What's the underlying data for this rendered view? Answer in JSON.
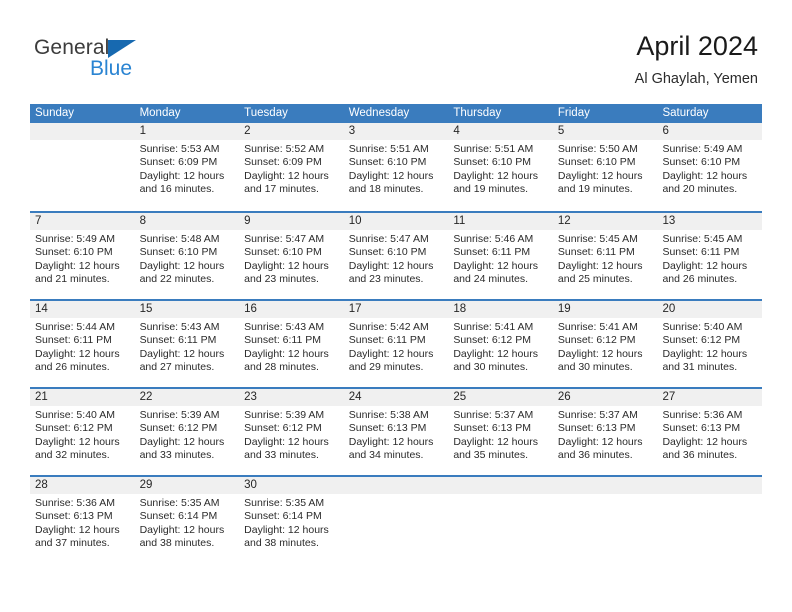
{
  "brand": {
    "word_one": "General",
    "word_two": "Blue",
    "triangle_icon": "triangle-icon",
    "color_dark": "#3c3c3c",
    "color_blue": "#2a84d2"
  },
  "header": {
    "title": "April 2024",
    "subtitle": "Al Ghaylah, Yemen"
  },
  "calendar": {
    "accent_color": "#3a7cbe",
    "daynum_band_color": "#f0f0f0",
    "day_names": [
      "Sunday",
      "Monday",
      "Tuesday",
      "Wednesday",
      "Thursday",
      "Friday",
      "Saturday"
    ],
    "weeks": [
      [
        {
          "day": "",
          "sunrise": "",
          "sunset": "",
          "daylight_1": "",
          "daylight_2": ""
        },
        {
          "day": "1",
          "sunrise": "Sunrise: 5:53 AM",
          "sunset": "Sunset: 6:09 PM",
          "daylight_1": "Daylight: 12 hours",
          "daylight_2": "and 16 minutes."
        },
        {
          "day": "2",
          "sunrise": "Sunrise: 5:52 AM",
          "sunset": "Sunset: 6:09 PM",
          "daylight_1": "Daylight: 12 hours",
          "daylight_2": "and 17 minutes."
        },
        {
          "day": "3",
          "sunrise": "Sunrise: 5:51 AM",
          "sunset": "Sunset: 6:10 PM",
          "daylight_1": "Daylight: 12 hours",
          "daylight_2": "and 18 minutes."
        },
        {
          "day": "4",
          "sunrise": "Sunrise: 5:51 AM",
          "sunset": "Sunset: 6:10 PM",
          "daylight_1": "Daylight: 12 hours",
          "daylight_2": "and 19 minutes."
        },
        {
          "day": "5",
          "sunrise": "Sunrise: 5:50 AM",
          "sunset": "Sunset: 6:10 PM",
          "daylight_1": "Daylight: 12 hours",
          "daylight_2": "and 19 minutes."
        },
        {
          "day": "6",
          "sunrise": "Sunrise: 5:49 AM",
          "sunset": "Sunset: 6:10 PM",
          "daylight_1": "Daylight: 12 hours",
          "daylight_2": "and 20 minutes."
        }
      ],
      [
        {
          "day": "7",
          "sunrise": "Sunrise: 5:49 AM",
          "sunset": "Sunset: 6:10 PM",
          "daylight_1": "Daylight: 12 hours",
          "daylight_2": "and 21 minutes."
        },
        {
          "day": "8",
          "sunrise": "Sunrise: 5:48 AM",
          "sunset": "Sunset: 6:10 PM",
          "daylight_1": "Daylight: 12 hours",
          "daylight_2": "and 22 minutes."
        },
        {
          "day": "9",
          "sunrise": "Sunrise: 5:47 AM",
          "sunset": "Sunset: 6:10 PM",
          "daylight_1": "Daylight: 12 hours",
          "daylight_2": "and 23 minutes."
        },
        {
          "day": "10",
          "sunrise": "Sunrise: 5:47 AM",
          "sunset": "Sunset: 6:10 PM",
          "daylight_1": "Daylight: 12 hours",
          "daylight_2": "and 23 minutes."
        },
        {
          "day": "11",
          "sunrise": "Sunrise: 5:46 AM",
          "sunset": "Sunset: 6:11 PM",
          "daylight_1": "Daylight: 12 hours",
          "daylight_2": "and 24 minutes."
        },
        {
          "day": "12",
          "sunrise": "Sunrise: 5:45 AM",
          "sunset": "Sunset: 6:11 PM",
          "daylight_1": "Daylight: 12 hours",
          "daylight_2": "and 25 minutes."
        },
        {
          "day": "13",
          "sunrise": "Sunrise: 5:45 AM",
          "sunset": "Sunset: 6:11 PM",
          "daylight_1": "Daylight: 12 hours",
          "daylight_2": "and 26 minutes."
        }
      ],
      [
        {
          "day": "14",
          "sunrise": "Sunrise: 5:44 AM",
          "sunset": "Sunset: 6:11 PM",
          "daylight_1": "Daylight: 12 hours",
          "daylight_2": "and 26 minutes."
        },
        {
          "day": "15",
          "sunrise": "Sunrise: 5:43 AM",
          "sunset": "Sunset: 6:11 PM",
          "daylight_1": "Daylight: 12 hours",
          "daylight_2": "and 27 minutes."
        },
        {
          "day": "16",
          "sunrise": "Sunrise: 5:43 AM",
          "sunset": "Sunset: 6:11 PM",
          "daylight_1": "Daylight: 12 hours",
          "daylight_2": "and 28 minutes."
        },
        {
          "day": "17",
          "sunrise": "Sunrise: 5:42 AM",
          "sunset": "Sunset: 6:11 PM",
          "daylight_1": "Daylight: 12 hours",
          "daylight_2": "and 29 minutes."
        },
        {
          "day": "18",
          "sunrise": "Sunrise: 5:41 AM",
          "sunset": "Sunset: 6:12 PM",
          "daylight_1": "Daylight: 12 hours",
          "daylight_2": "and 30 minutes."
        },
        {
          "day": "19",
          "sunrise": "Sunrise: 5:41 AM",
          "sunset": "Sunset: 6:12 PM",
          "daylight_1": "Daylight: 12 hours",
          "daylight_2": "and 30 minutes."
        },
        {
          "day": "20",
          "sunrise": "Sunrise: 5:40 AM",
          "sunset": "Sunset: 6:12 PM",
          "daylight_1": "Daylight: 12 hours",
          "daylight_2": "and 31 minutes."
        }
      ],
      [
        {
          "day": "21",
          "sunrise": "Sunrise: 5:40 AM",
          "sunset": "Sunset: 6:12 PM",
          "daylight_1": "Daylight: 12 hours",
          "daylight_2": "and 32 minutes."
        },
        {
          "day": "22",
          "sunrise": "Sunrise: 5:39 AM",
          "sunset": "Sunset: 6:12 PM",
          "daylight_1": "Daylight: 12 hours",
          "daylight_2": "and 33 minutes."
        },
        {
          "day": "23",
          "sunrise": "Sunrise: 5:39 AM",
          "sunset": "Sunset: 6:12 PM",
          "daylight_1": "Daylight: 12 hours",
          "daylight_2": "and 33 minutes."
        },
        {
          "day": "24",
          "sunrise": "Sunrise: 5:38 AM",
          "sunset": "Sunset: 6:13 PM",
          "daylight_1": "Daylight: 12 hours",
          "daylight_2": "and 34 minutes."
        },
        {
          "day": "25",
          "sunrise": "Sunrise: 5:37 AM",
          "sunset": "Sunset: 6:13 PM",
          "daylight_1": "Daylight: 12 hours",
          "daylight_2": "and 35 minutes."
        },
        {
          "day": "26",
          "sunrise": "Sunrise: 5:37 AM",
          "sunset": "Sunset: 6:13 PM",
          "daylight_1": "Daylight: 12 hours",
          "daylight_2": "and 36 minutes."
        },
        {
          "day": "27",
          "sunrise": "Sunrise: 5:36 AM",
          "sunset": "Sunset: 6:13 PM",
          "daylight_1": "Daylight: 12 hours",
          "daylight_2": "and 36 minutes."
        }
      ],
      [
        {
          "day": "28",
          "sunrise": "Sunrise: 5:36 AM",
          "sunset": "Sunset: 6:13 PM",
          "daylight_1": "Daylight: 12 hours",
          "daylight_2": "and 37 minutes."
        },
        {
          "day": "29",
          "sunrise": "Sunrise: 5:35 AM",
          "sunset": "Sunset: 6:14 PM",
          "daylight_1": "Daylight: 12 hours",
          "daylight_2": "and 38 minutes."
        },
        {
          "day": "30",
          "sunrise": "Sunrise: 5:35 AM",
          "sunset": "Sunset: 6:14 PM",
          "daylight_1": "Daylight: 12 hours",
          "daylight_2": "and 38 minutes."
        },
        {
          "day": "",
          "sunrise": "",
          "sunset": "",
          "daylight_1": "",
          "daylight_2": ""
        },
        {
          "day": "",
          "sunrise": "",
          "sunset": "",
          "daylight_1": "",
          "daylight_2": ""
        },
        {
          "day": "",
          "sunrise": "",
          "sunset": "",
          "daylight_1": "",
          "daylight_2": ""
        },
        {
          "day": "",
          "sunrise": "",
          "sunset": "",
          "daylight_1": "",
          "daylight_2": ""
        }
      ]
    ]
  }
}
